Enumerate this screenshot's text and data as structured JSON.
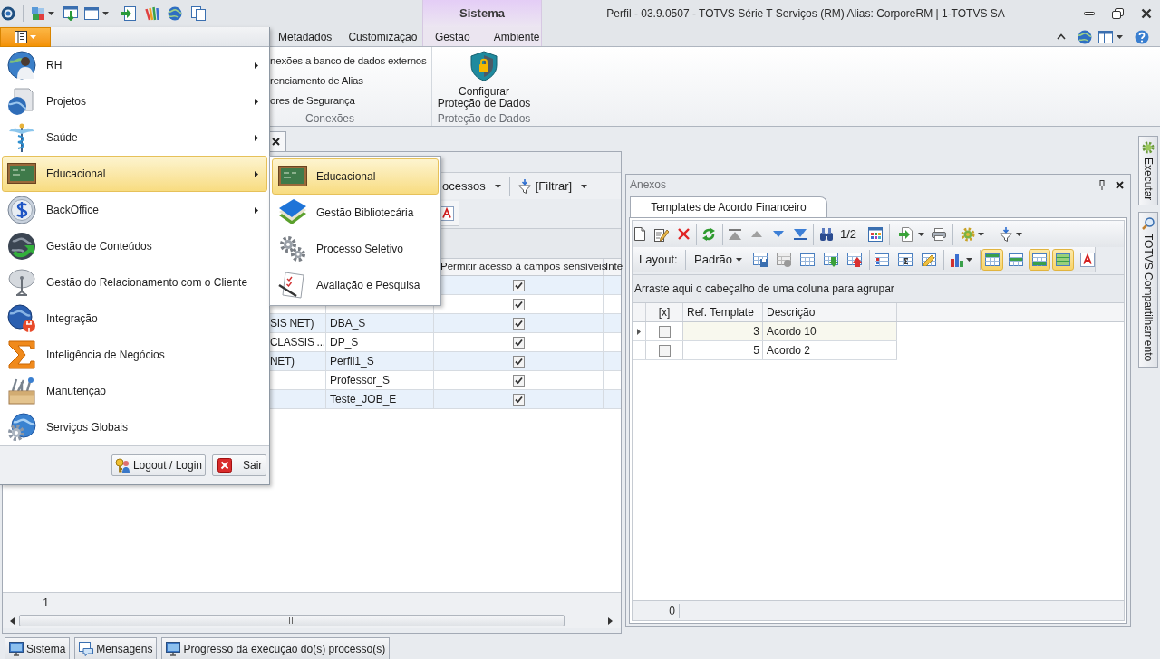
{
  "window": {
    "title": "Perfil - 03.9.0507 - TOTVS Série T Serviços (RM) Alias: CorporeRM | 1-TOTVS SA",
    "contextual_group": "Sistema"
  },
  "ribbon": {
    "tabs": [
      {
        "label": "Metadados",
        "selected": false
      },
      {
        "label": "Customização",
        "selected": false
      }
    ],
    "contextual_tabs": [
      {
        "label": "Gestão",
        "selected": false
      },
      {
        "label": "Ambiente",
        "selected": false
      }
    ],
    "groups": [
      {
        "kind": "list",
        "label": "Conexões",
        "items": [
          "nexões a banco de dados externos",
          "renciamento de Alias",
          "ores de Segurança"
        ]
      },
      {
        "kind": "large",
        "label": "Proteção de Dados",
        "button": "Configurar Proteção de Dados"
      }
    ]
  },
  "app_menu": {
    "items": [
      {
        "label": "RH",
        "submenu": true,
        "selected": false
      },
      {
        "label": "Projetos",
        "submenu": true,
        "selected": false
      },
      {
        "label": "Saúde",
        "submenu": true,
        "selected": false
      },
      {
        "label": "Educacional",
        "submenu": true,
        "selected": true
      },
      {
        "label": "BackOffice",
        "submenu": true,
        "selected": false
      },
      {
        "label": "Gestão de Conteúdos",
        "submenu": false,
        "selected": false
      },
      {
        "label": "Gestão do Relacionamento com o Cliente",
        "submenu": false,
        "selected": false
      },
      {
        "label": "Integração",
        "submenu": false,
        "selected": false
      },
      {
        "label": "Inteligência de Negócios",
        "submenu": false,
        "selected": false
      },
      {
        "label": "Manutenção",
        "submenu": false,
        "selected": false
      },
      {
        "label": "Serviços Globais",
        "submenu": false,
        "selected": false
      }
    ],
    "submenu": [
      {
        "label": "Educacional",
        "selected": true
      },
      {
        "label": "Gestão Bibliotecária",
        "selected": false
      },
      {
        "label": "Processo Seletivo",
        "selected": false
      },
      {
        "label": "Avaliação e Pesquisa",
        "selected": false
      }
    ],
    "buttons": [
      "Logout / Login",
      "Sair"
    ]
  },
  "document": {
    "toolbar": [
      {
        "kind": "menu",
        "label": "ocessos",
        "dropdown": true
      },
      {
        "kind": "filter",
        "label": "[Filtrar]",
        "dropdown": true
      }
    ],
    "table": {
      "columns": [
        "Permitir acesso à campos sensíveis",
        "Inte"
      ],
      "rows": [
        {
          "checked": true
        },
        {
          "checked": true
        },
        {
          "column_1": "SIS NET)",
          "column_2": "DBA_S",
          "checked": true
        },
        {
          "column_1": "CLASSIS ...",
          "column_2": "DP_S",
          "checked": true
        },
        {
          "column_1": "NET)",
          "column_2": "Perfil1_S",
          "checked": true
        },
        {
          "column_2": "Professor_S",
          "checked": true
        },
        {
          "column_2": "Teste_JOB_E",
          "checked": true
        }
      ]
    },
    "footer": "1"
  },
  "anexos": {
    "title": "Anexos",
    "tabs": [
      {
        "label": "Templates de Acordo Financeiro",
        "selected": true
      }
    ],
    "toolbar": {
      "page": "1/2"
    },
    "layout_bar": {
      "label": "Layout:",
      "layout": "Padrão",
      "view_toggles": [
        {
          "on": true
        },
        {
          "on": false
        },
        {
          "on": true
        },
        {
          "on": true
        }
      ]
    },
    "group_panel": "Arraste aqui o cabeçalho de uma coluna para agrupar",
    "grid": {
      "columns": [
        "[x]",
        "Ref. Template",
        "Descrição"
      ],
      "rows": [
        {
          "selected": true,
          "checked": false,
          "ref": "3",
          "description": "Acordo 10"
        },
        {
          "selected": false,
          "checked": false,
          "ref": "5",
          "description": "Acordo 2"
        }
      ]
    },
    "footer": "0"
  },
  "side_tabs": [
    {
      "label": "Executar"
    },
    {
      "label": "TOTVS Compartilhamento"
    }
  ],
  "taskbar": [
    {
      "label": "Sistema"
    },
    {
      "label": "Mensagens"
    },
    {
      "label": "Progresso da execução do(s) processo(s)"
    }
  ]
}
